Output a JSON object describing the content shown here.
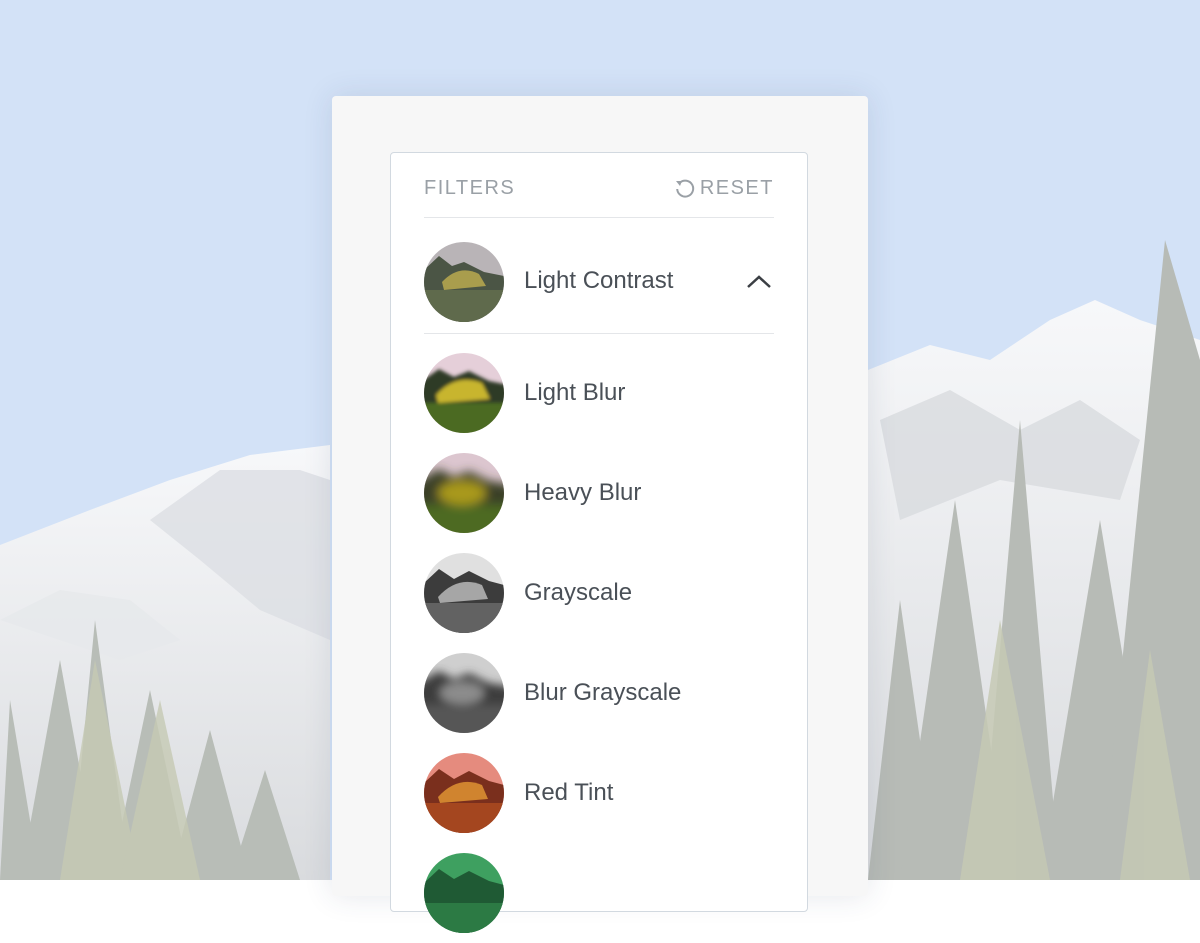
{
  "filters": {
    "title": "FILTERS",
    "reset_label": "RESET",
    "selected": {
      "label": "Light Contrast",
      "icon": "chevron-up-icon"
    },
    "options": [
      {
        "label": "Light Blur"
      },
      {
        "label": "Heavy Blur"
      },
      {
        "label": "Grayscale"
      },
      {
        "label": "Blur Grayscale"
      },
      {
        "label": "Red Tint"
      },
      {
        "label": ""
      }
    ]
  },
  "colors": {
    "sky": "#d3e2f7",
    "text": "#4a5057",
    "muted": "#9aa0a6",
    "panel_border": "#d2d9e0"
  }
}
